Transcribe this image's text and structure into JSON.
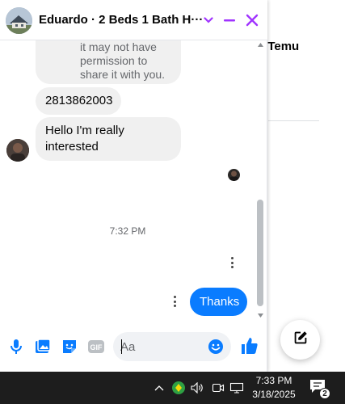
{
  "background": {
    "partial_text": "n Temu"
  },
  "chat": {
    "title": "Eduardo · 2 Beds 1 Bath H···",
    "messages": {
      "info_text": "it may not have permission to share it with you.",
      "phone": "2813862003",
      "interest": "Hello I'm really interested",
      "time_separator": "7:32 PM",
      "sent": "Thanks"
    },
    "composer": {
      "placeholder": "Aa"
    }
  },
  "taskbar": {
    "time": "7:33 PM",
    "date": "3/18/2025",
    "notification_count": "2"
  },
  "colors": {
    "accent": "#a033ff",
    "messenger_blue": "#0a7cff",
    "taskbar": "#1d1d1d"
  }
}
